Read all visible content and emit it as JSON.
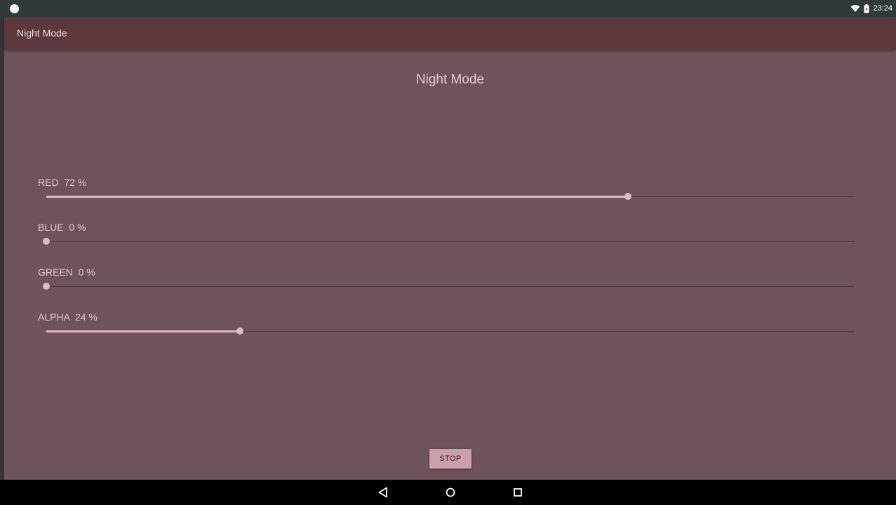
{
  "status_bar": {
    "time": "23:24",
    "icons": [
      "notification-dot-icon",
      "wifi-icon",
      "battery-icon"
    ]
  },
  "app_bar": {
    "title": "Night Mode"
  },
  "main": {
    "heading": "Night Mode",
    "sliders": [
      {
        "label": "RED  72 %",
        "value_percent": 72
      },
      {
        "label": "BLUE  0 %",
        "value_percent": 0
      },
      {
        "label": "GREEN  0 %",
        "value_percent": 0
      },
      {
        "label": "ALPHA  24 %",
        "value_percent": 24
      }
    ],
    "stop_label": "STOP"
  },
  "nav_bar": {
    "icons": [
      "back-icon",
      "home-icon",
      "recents-icon"
    ]
  },
  "colors": {
    "app_bar": "#5c373c",
    "content_background": "#6e535b",
    "accent": "#e6b7bd",
    "button": "#cca0a8"
  }
}
